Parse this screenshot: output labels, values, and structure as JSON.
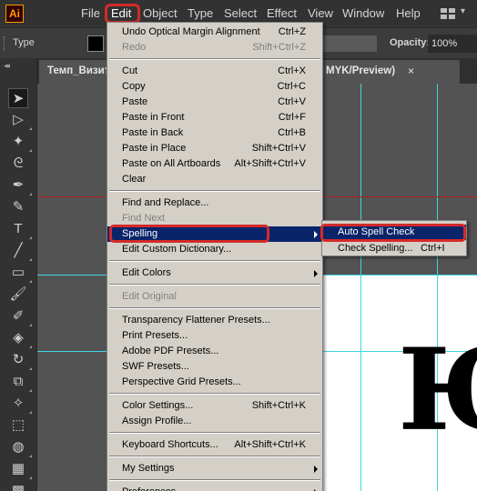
{
  "app": {
    "logo": "Ai"
  },
  "menubar": {
    "items": [
      "File",
      "Edit",
      "Object",
      "Type",
      "Select",
      "Effect",
      "View",
      "Window",
      "Help"
    ],
    "active": "Edit",
    "workspace_icon": "workspace-grid-icon"
  },
  "control_bar": {
    "type_label": "Type",
    "opacity_label": "Opacity:",
    "opacity_value": "100%"
  },
  "document_tab": {
    "title": "Темп_Визит",
    "title_tail": "MYK/Preview)",
    "close": "×"
  },
  "edit_menu": {
    "groups": [
      [
        {
          "label": "Undo Optical Margin Alignment",
          "shortcut": "Ctrl+Z",
          "disabled": false
        },
        {
          "label": "Redo",
          "shortcut": "Shift+Ctrl+Z",
          "disabled": true
        }
      ],
      [
        {
          "label": "Cut",
          "shortcut": "Ctrl+X",
          "disabled": false
        },
        {
          "label": "Copy",
          "shortcut": "Ctrl+C",
          "disabled": false
        },
        {
          "label": "Paste",
          "shortcut": "Ctrl+V",
          "disabled": false
        },
        {
          "label": "Paste in Front",
          "shortcut": "Ctrl+F",
          "disabled": false
        },
        {
          "label": "Paste in Back",
          "shortcut": "Ctrl+B",
          "disabled": false
        },
        {
          "label": "Paste in Place",
          "shortcut": "Shift+Ctrl+V",
          "disabled": false
        },
        {
          "label": "Paste on All Artboards",
          "shortcut": "Alt+Shift+Ctrl+V",
          "disabled": false
        },
        {
          "label": "Clear",
          "shortcut": "",
          "disabled": false
        }
      ],
      [
        {
          "label": "Find and Replace...",
          "shortcut": "",
          "disabled": false
        },
        {
          "label": "Find Next",
          "shortcut": "",
          "disabled": true
        },
        {
          "label": "Spelling",
          "shortcut": "",
          "disabled": false,
          "submenu": true,
          "highlighted": true
        },
        {
          "label": "Edit Custom Dictionary...",
          "shortcut": "",
          "disabled": false
        }
      ],
      [
        {
          "label": "Edit Colors",
          "shortcut": "",
          "disabled": false,
          "submenu": true
        }
      ],
      [
        {
          "label": "Edit Original",
          "shortcut": "",
          "disabled": true
        }
      ],
      [
        {
          "label": "Transparency Flattener Presets...",
          "shortcut": "",
          "disabled": false
        },
        {
          "label": "Print Presets...",
          "shortcut": "",
          "disabled": false
        },
        {
          "label": "Adobe PDF Presets...",
          "shortcut": "",
          "disabled": false
        },
        {
          "label": "SWF Presets...",
          "shortcut": "",
          "disabled": false
        },
        {
          "label": "Perspective Grid Presets...",
          "shortcut": "",
          "disabled": false
        }
      ],
      [
        {
          "label": "Color Settings...",
          "shortcut": "Shift+Ctrl+K",
          "disabled": false
        },
        {
          "label": "Assign Profile...",
          "shortcut": "",
          "disabled": false
        }
      ],
      [
        {
          "label": "Keyboard Shortcuts...",
          "shortcut": "Alt+Shift+Ctrl+K",
          "disabled": false
        }
      ],
      [
        {
          "label": "My Settings",
          "shortcut": "",
          "disabled": false,
          "submenu": true
        }
      ],
      [
        {
          "label": "Preferences",
          "shortcut": "",
          "disabled": false,
          "submenu": true
        }
      ]
    ]
  },
  "spelling_submenu": {
    "items": [
      {
        "label": "Auto Spell Check",
        "shortcut": "",
        "highlighted": true
      },
      {
        "label": "Check Spelling...",
        "shortcut": "Ctrl+I",
        "highlighted": false
      }
    ]
  },
  "canvas": {
    "glyph": "Ю"
  },
  "tools": [
    "selection-tool-icon",
    "direct-selection-tool-icon",
    "magic-wand-tool-icon",
    "lasso-tool-icon",
    "pen-tool-icon",
    "curvature-tool-icon",
    "type-tool-icon",
    "line-segment-tool-icon",
    "rectangle-tool-icon",
    "paintbrush-tool-icon",
    "shaper-tool-icon",
    "eraser-tool-icon",
    "rotate-tool-icon",
    "scale-tool-icon",
    "puppet-warp-tool-icon",
    "free-transform-tool-icon",
    "shape-builder-tool-icon",
    "perspective-grid-tool-icon",
    "mesh-tool-icon"
  ],
  "colors": {
    "menu_bg": "#d4d0c8",
    "menu_highlight": "#0a246a",
    "annotation": "#d42a2a",
    "guide": "#3fd6e0"
  }
}
